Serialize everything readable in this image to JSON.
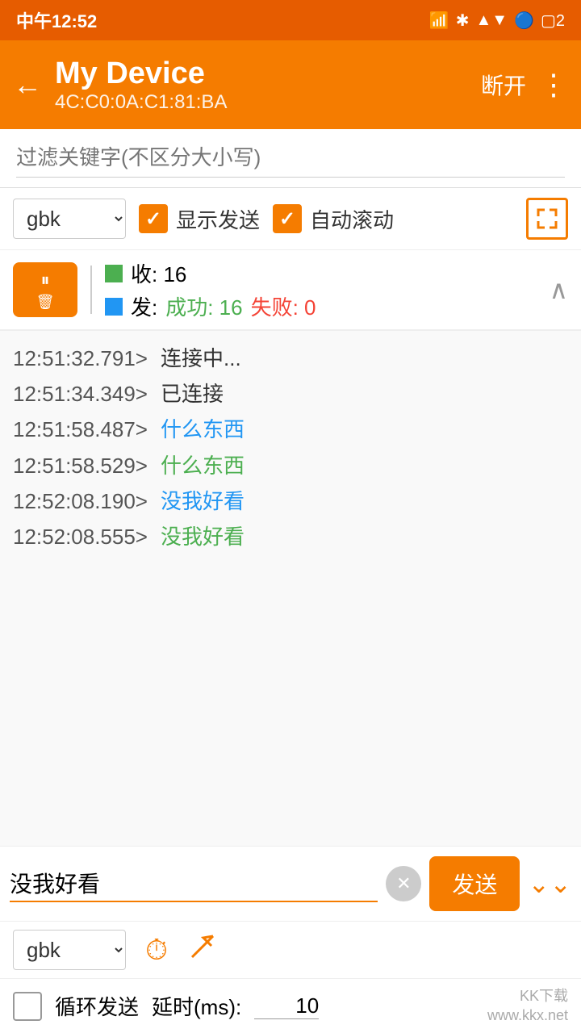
{
  "statusBar": {
    "time": "中午12:52",
    "icons": [
      "signal",
      "bluetooth",
      "network",
      "wifi",
      "battery"
    ]
  },
  "toolbar": {
    "deviceName": "My Device",
    "deviceMac": "4C:C0:0A:C1:81:BA",
    "disconnectLabel": "断开",
    "menuIcon": "⋮"
  },
  "filter": {
    "placeholder": "过滤关键字(不区分大小写)"
  },
  "controls": {
    "encoding": "gbk",
    "showSendLabel": "显示发送",
    "autoScrollLabel": "自动滚动"
  },
  "stats": {
    "recvLabel": "收: 16",
    "sendLabel": "发:",
    "successLabel": "成功: 16",
    "failLabel": "失败: 0"
  },
  "log": {
    "entries": [
      {
        "time": "12:51:32.791>",
        "msg": "连接中...",
        "color": "gray"
      },
      {
        "time": "12:51:34.349>",
        "msg": "已连接",
        "color": "gray"
      },
      {
        "time": "12:51:58.487>",
        "msg": "什么东西",
        "color": "blue"
      },
      {
        "time": "12:51:58.529>",
        "msg": "什么东西",
        "color": "green"
      },
      {
        "time": "12:52:08.190>",
        "msg": "没我好看",
        "color": "blue"
      },
      {
        "time": "12:52:08.555>",
        "msg": "没我好看",
        "color": "green"
      }
    ]
  },
  "input": {
    "messageValue": "没我好看",
    "sendLabel": "发送",
    "encoding": "gbk",
    "loopLabel": "循环发送",
    "delayLabel": "延时(ms):",
    "delayValue": "10"
  },
  "watermark": {
    "line1": "KK下载",
    "line2": "www.kkx.net"
  }
}
